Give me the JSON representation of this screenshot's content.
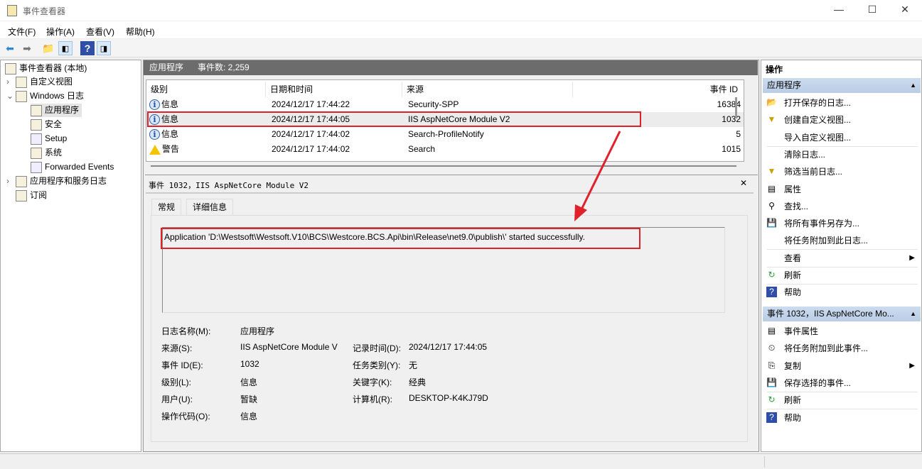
{
  "window": {
    "title": "事件查看器",
    "minimize": "—",
    "maximize": "☐",
    "close": "✕"
  },
  "menu": [
    "文件(F)",
    "操作(A)",
    "查看(V)",
    "帮助(H)"
  ],
  "tree": {
    "root": "事件查看器 (本地)",
    "items": [
      {
        "label": "自定义视图",
        "expander": "›"
      },
      {
        "label": "Windows 日志",
        "expander": "⌄"
      },
      {
        "label": "应用程序"
      },
      {
        "label": "安全"
      },
      {
        "label": "Setup"
      },
      {
        "label": "系统"
      },
      {
        "label": "Forwarded Events"
      },
      {
        "label": "应用程序和服务日志",
        "expander": "›"
      },
      {
        "label": "订阅"
      }
    ]
  },
  "log": {
    "name": "应用程序",
    "count": "事件数: 2,259"
  },
  "columns": [
    "级别",
    "日期和时间",
    "来源",
    "事件 ID"
  ],
  "rows": [
    {
      "level": "信息",
      "icon": "info",
      "date": "2024/12/17 17:44:22",
      "source": "Security-SPP",
      "id": "16384"
    },
    {
      "level": "信息",
      "icon": "info",
      "date": "2024/12/17 17:44:05",
      "source": "IIS AspNetCore Module V2",
      "id": "1032"
    },
    {
      "level": "信息",
      "icon": "info",
      "date": "2024/12/17 17:44:02",
      "source": "Search-ProfileNotify",
      "id": "5"
    },
    {
      "level": "警告",
      "icon": "warning",
      "date": "2024/12/17 17:44:02",
      "source": "Search",
      "id": "1015"
    }
  ],
  "detail": {
    "title": "事件 1032，IIS AspNetCore Module V2",
    "close": "✕",
    "tabs": [
      "常规",
      "详细信息"
    ],
    "message": "Application 'D:\\Westsoft\\Westsoft.V10\\BCS\\Westcore.BCS.Api\\bin\\Release\\net9.0\\publish\\' started successfully.",
    "fields": [
      {
        "label": "日志名称(M):",
        "value": "应用程序"
      },
      {
        "label": "来源(S):",
        "value": "IIS AspNetCore Module V"
      },
      {
        "label": "事件 ID(E):",
        "value": "1032"
      },
      {
        "label": "级别(L):",
        "value": "信息"
      },
      {
        "label": "用户(U):",
        "value": "暂缺"
      },
      {
        "label": "操作代码(O):",
        "value": "信息"
      }
    ],
    "fields2": [
      {
        "label": "记录时间(D):",
        "value": "2024/12/17 17:44:05"
      },
      {
        "label": "任务类别(Y):",
        "value": "无"
      },
      {
        "label": "关键字(K):",
        "value": "经典"
      },
      {
        "label": "计算机(R):",
        "value": "DESKTOP-K4KJ79D"
      }
    ]
  },
  "actions": {
    "title": "操作",
    "section1": "应用程序",
    "items1": [
      {
        "label": "打开保存的日志...",
        "icon": "📂"
      },
      {
        "label": "创建自定义视图...",
        "icon": "▼"
      },
      {
        "label": "导入自定义视图...",
        "icon": ""
      },
      {
        "label": "清除日志...",
        "icon": ""
      },
      {
        "label": "筛选当前日志...",
        "icon": "▼"
      },
      {
        "label": "属性",
        "icon": "▤"
      },
      {
        "label": "查找...",
        "icon": "⚲"
      },
      {
        "label": "将所有事件另存为...",
        "icon": "💾"
      },
      {
        "label": "将任务附加到此日志...",
        "icon": ""
      },
      {
        "label": "查看",
        "icon": "",
        "sub": "▶"
      },
      {
        "label": "刷新",
        "icon": "↻"
      },
      {
        "label": "帮助",
        "icon": "?"
      }
    ],
    "section2": "事件 1032，IIS AspNetCore Mo...",
    "items2": [
      {
        "label": "事件属性",
        "icon": "▤"
      },
      {
        "label": "将任务附加到此事件...",
        "icon": "⏲"
      },
      {
        "label": "复制",
        "icon": "⎘",
        "sub": "▶"
      },
      {
        "label": "保存选择的事件...",
        "icon": "💾"
      },
      {
        "label": "刷新",
        "icon": "↻"
      },
      {
        "label": "帮助",
        "icon": "?"
      }
    ]
  },
  "colors": {
    "accent": "#e0202a",
    "header": "#6c6c6c",
    "section": "#c5d7ed"
  }
}
